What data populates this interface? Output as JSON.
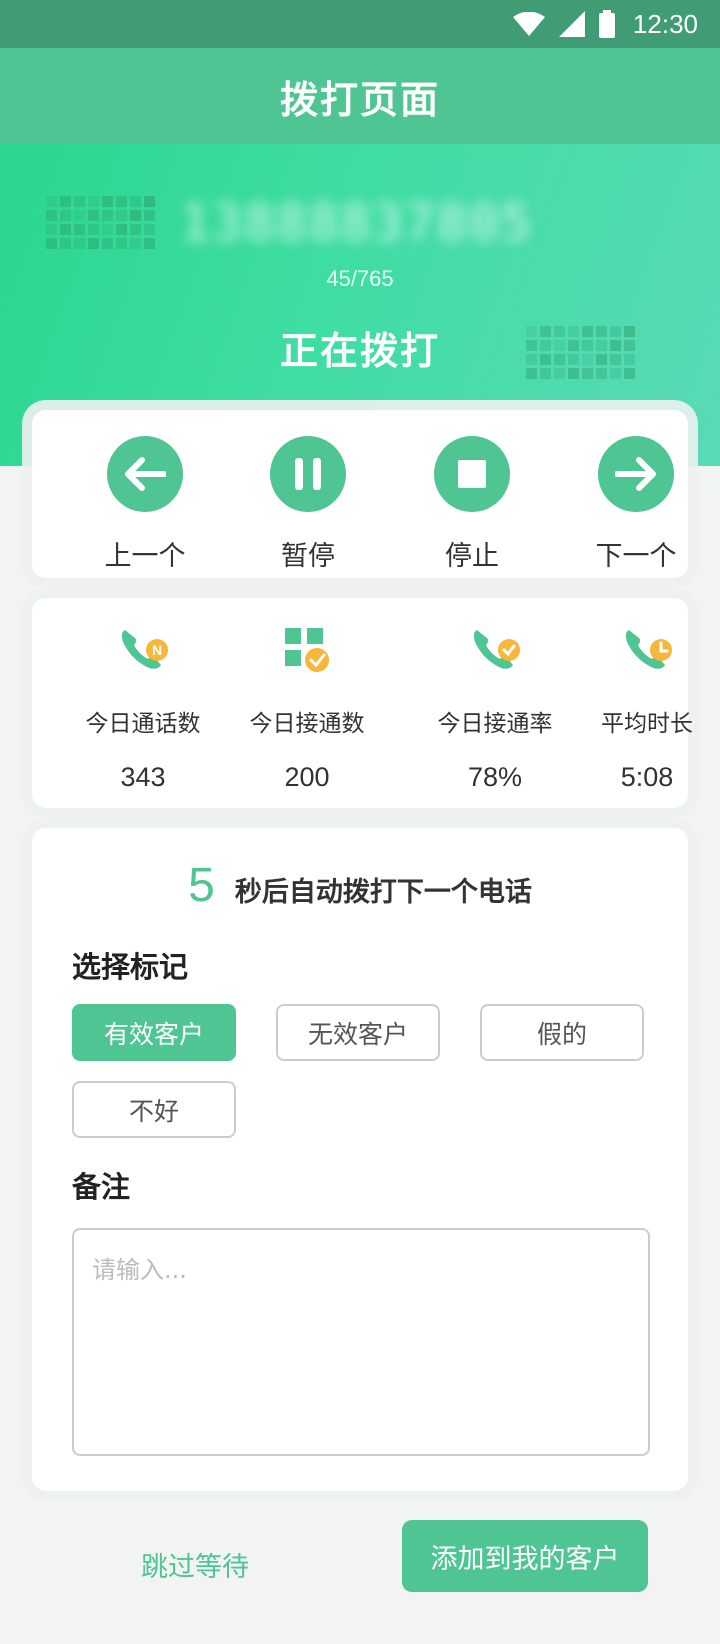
{
  "status_bar": {
    "time": "12:30"
  },
  "title": "拨打页面",
  "hero": {
    "phone_number": "13888837805",
    "progress": "45/765",
    "status": "正在拨打"
  },
  "controls": [
    {
      "label": "上一个",
      "icon": "arrow-left-icon"
    },
    {
      "label": "暂停",
      "icon": "pause-icon"
    },
    {
      "label": "停止",
      "icon": "stop-icon"
    },
    {
      "label": "下一个",
      "icon": "arrow-right-icon"
    }
  ],
  "stats": [
    {
      "label": "今日通话数",
      "value": "343",
      "icon": "phone-new-icon",
      "badge": "N"
    },
    {
      "label": "今日接通数",
      "value": "200",
      "icon": "grid-check-icon"
    },
    {
      "label": "今日接通率",
      "value": "78%",
      "icon": "phone-check-icon"
    },
    {
      "label": "平均时长",
      "value": "5:08",
      "icon": "phone-clock-icon"
    }
  ],
  "countdown": {
    "seconds": "5",
    "message": "秒后自动拨打下一个电话"
  },
  "mark": {
    "title": "选择标记",
    "options": [
      "有效客户",
      "无效客户",
      "假的",
      "不好"
    ],
    "selected": "有效客户"
  },
  "remark": {
    "title": "备注",
    "placeholder": "请输入..."
  },
  "footer": {
    "skip_label": "跳过等待",
    "add_label": "添加到我的客户"
  },
  "colors": {
    "primary": "#4fc594",
    "accent_orange": "#f6b73c",
    "status_bar": "#3f9c74"
  }
}
